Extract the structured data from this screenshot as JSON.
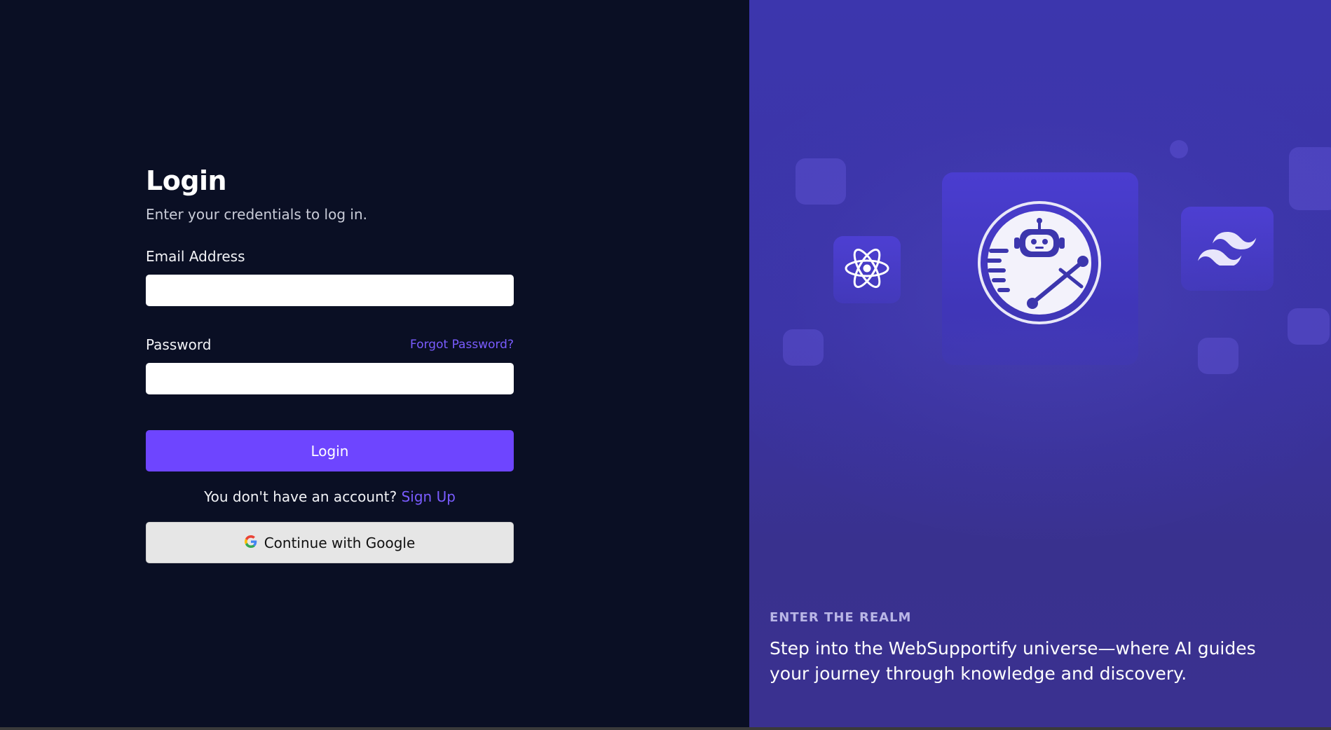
{
  "login": {
    "title": "Login",
    "subtitle": "Enter your credentials to log in.",
    "email_label": "Email Address",
    "email_value": "",
    "password_label": "Password",
    "password_value": "",
    "forgot_password": "Forgot Password?",
    "submit_label": "Login",
    "signup_prompt": "You don't have an account?",
    "signup_link": "Sign Up",
    "google_button": "Continue with Google"
  },
  "hero": {
    "eyebrow": "ENTER THE REALM",
    "tagline": "Step into the WebSupportify universe—where AI guides your journey through knowledge and discovery.",
    "icons": [
      "react-icon",
      "robot-logo-icon",
      "tailwind-icon"
    ]
  },
  "colors": {
    "left_background": "#0a0f24",
    "accent": "#6e45ff",
    "link": "#7a5cff",
    "right_background": "#3c36ad",
    "google_button_background": "#e6e6e6"
  }
}
